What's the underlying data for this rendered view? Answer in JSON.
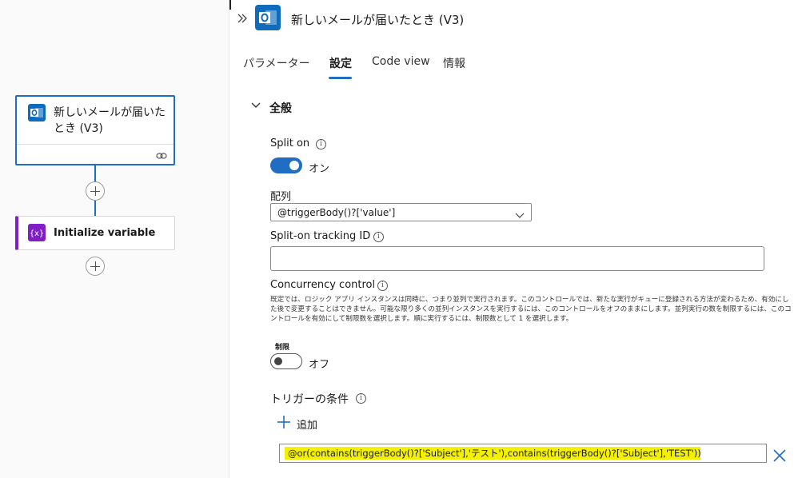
{
  "canvas": {
    "trigger_card": {
      "title": "新しいメールが届いたとき (V3)",
      "icon": "outlook-icon"
    },
    "variable_card": {
      "title": "Initialize variable",
      "icon": "variable-icon"
    }
  },
  "panel": {
    "title": "新しいメールが届いたとき (V3)",
    "tabs": [
      {
        "label": "パラメーター"
      },
      {
        "label": "設定"
      },
      {
        "label": "Code view"
      },
      {
        "label": "情報"
      }
    ],
    "active_tab": "設定",
    "section": {
      "title": "全般"
    },
    "split_on": {
      "label": "Split on",
      "state": "オン"
    },
    "array": {
      "label": "配列",
      "value": "@triggerBody()?['value']"
    },
    "tracking_id": {
      "label": "Split-on tracking ID",
      "value": ""
    },
    "concurrency": {
      "label": "Concurrency control",
      "description": "既定では、ロジック アプリ インスタンスは同時に、つまり並列で実行されます。このコントロールでは、新たな実行がキューに登録される方法が変わるため、有効にした後で変更することはできません。可能な限り多くの並列インスタンスを実行するには、このコントロールをオフのままにします。並列実行の数を制限するには、このコントロールを有効にして制限数を選択します。順に実行するには、制限数として 1 を選択します。",
      "limit_label": "制限",
      "state": "オフ"
    },
    "trigger_conditions": {
      "label": "トリガーの条件",
      "add_label": "追加",
      "condition": "@or(contains(triggerBody()?['Subject'],'テスト'),contains(triggerBody()?['Subject'],'TEST'))"
    }
  },
  "colors": {
    "accent": "#1f6ec4",
    "variable_accent": "#7f1fc4",
    "highlight": "#f4f100",
    "outlook_blue": "#0f6cbd"
  }
}
